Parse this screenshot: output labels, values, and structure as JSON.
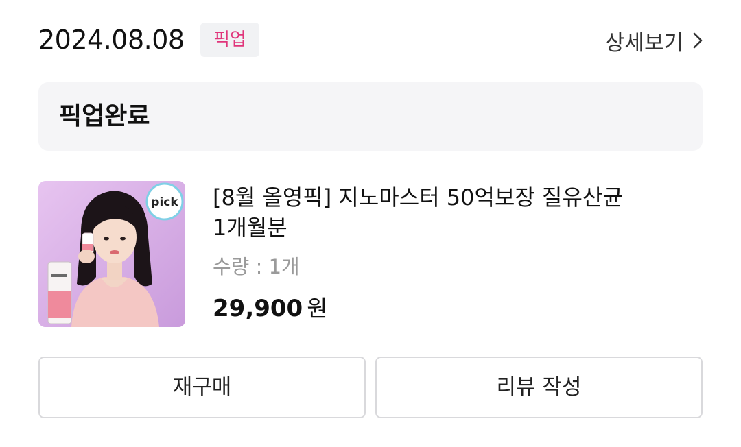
{
  "order": {
    "date": "2024.08.08",
    "type_badge": "픽업",
    "detail_link": "상세보기",
    "status": "픽업완료"
  },
  "product": {
    "name": "[8월 올영픽] 지노마스터 50억보장 질유산균 1개월분",
    "quantity": "수량 : 1개",
    "price": "29,900",
    "currency": "원",
    "thumbnail_badge": "pick"
  },
  "actions": {
    "rebuy": "재구매",
    "review": "리뷰 작성"
  },
  "colors": {
    "badge_text": "#e0357a",
    "badge_bg": "#f1f2f4",
    "status_bg": "#f5f5f7",
    "thumb_bg": "#d9b0e8",
    "button_border": "#d9d9dc"
  },
  "icons": {
    "detail_chevron": "chevron-right-icon"
  }
}
